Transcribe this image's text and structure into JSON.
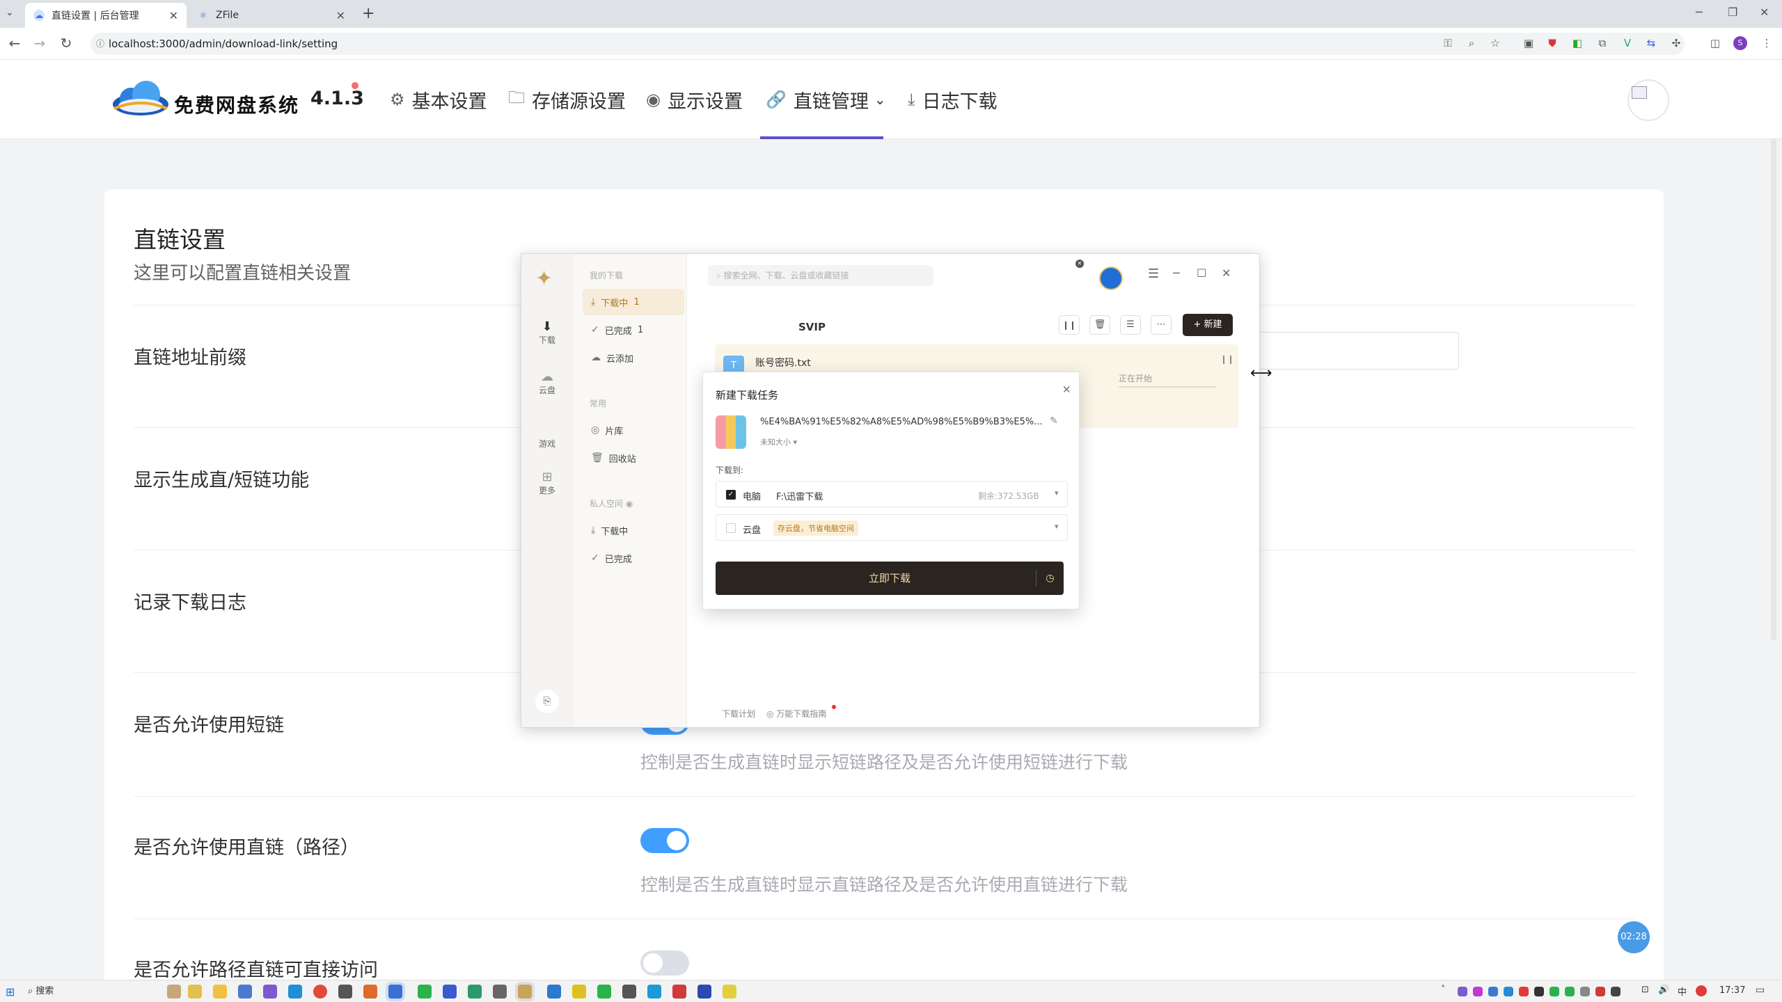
{
  "browser": {
    "tabs": [
      {
        "title": "直链设置 | 后台管理",
        "active": true
      },
      {
        "title": "ZFile",
        "active": false
      }
    ],
    "url": "localhost:3000/admin/download-link/setting"
  },
  "header": {
    "logo_text": "免费网盘系统",
    "version": "4.1.3",
    "nav": [
      {
        "label": "基本设置",
        "icon": "gear-icon"
      },
      {
        "label": "存储源设置",
        "icon": "folder-icon"
      },
      {
        "label": "显示设置",
        "icon": "eye-icon"
      },
      {
        "label": "直链管理",
        "icon": "link-icon",
        "active": true
      },
      {
        "label": "日志下载",
        "icon": "download-icon"
      }
    ]
  },
  "settings": {
    "title": "直链设置",
    "subtitle": "这里可以配置直链相关设置",
    "rows": [
      {
        "label": "直链地址前缀"
      },
      {
        "label": "显示生成直/短链功能"
      },
      {
        "label": "记录下载日志"
      },
      {
        "label": "是否允许使用短链",
        "desc": "控制是否生成直链时显示短链路径及是否允许使用短链进行下载",
        "on": true
      },
      {
        "label": "是否允许使用直链（路径）",
        "desc": "控制是否生成直链时显示直链路径及是否允许使用直链进行下载",
        "on": true
      },
      {
        "label": "是否允许路径直链可直接访问",
        "on": false
      }
    ]
  },
  "timer_badge": "02:28",
  "thunder": {
    "search_placeholder": "搜索全网、下载、云盘或收藏链接",
    "rail": [
      "下载",
      "云盘",
      "游戏",
      "更多"
    ],
    "groups": {
      "my": "我的下载",
      "common": "常用",
      "private": "私人空间"
    },
    "items": {
      "downloading": "下载中",
      "downloading_count": "1",
      "completed": "已完成",
      "completed_count": "1",
      "cloud_add": "云添加",
      "library": "片库",
      "recycle": "回收站",
      "p_downloading": "下载中",
      "p_completed": "已完成"
    },
    "svip": "SVIP",
    "new_button": "+ 新建",
    "task": {
      "filename": "账号密码.txt",
      "status": "正在开始"
    },
    "footer": {
      "plan": "下载计划",
      "guide": "万能下载指南"
    },
    "dialog": {
      "title": "新建下载任务",
      "file": "%E4%BA%91%E5%82%A8%E5%AD%98%E5%B9%B3%E5%...",
      "size": "未知大小",
      "dest_label": "下载到:",
      "pc": "电脑",
      "pc_path": "F:\\迅雷下载",
      "remain": "剩余:372.53GB",
      "cloud": "云盘",
      "cloud_tag": "存云盘，节省电脑空间",
      "download_button": "立即下载"
    }
  },
  "taskbar": {
    "search": "搜索",
    "time": "17:37",
    "ime": "中"
  },
  "colors": {
    "accent": "#409eff",
    "nav_active": "#5b52c8",
    "dark_button": "#2b2521"
  }
}
